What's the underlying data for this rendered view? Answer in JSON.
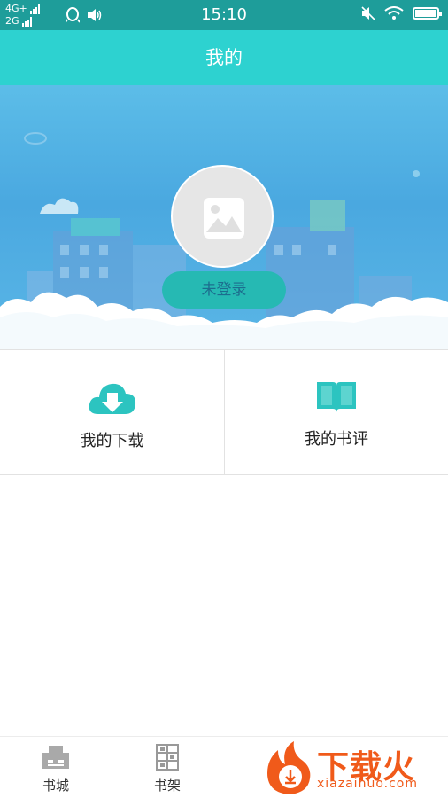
{
  "status_bar": {
    "network_top": "4G+",
    "network_bottom": "2G",
    "time": "15:10",
    "battery_level": 0.95
  },
  "header": {
    "title": "我的"
  },
  "profile": {
    "login_label": "未登录"
  },
  "features": [
    {
      "label": "我的下载",
      "icon": "cloud-download-icon"
    },
    {
      "label": "我的书评",
      "icon": "open-book-icon"
    }
  ],
  "bottom_nav": [
    {
      "label": "书城",
      "icon": "bookstore-icon"
    },
    {
      "label": "书架",
      "icon": "bookshelf-icon"
    }
  ],
  "watermark": {
    "brand": "下载火",
    "url": "xiazaihuo.com"
  },
  "colors": {
    "status_bar": "#1e9d9a",
    "title_bar": "#2dd2d0",
    "accent": "#2cc4c0",
    "watermark": "#f05a1a"
  }
}
